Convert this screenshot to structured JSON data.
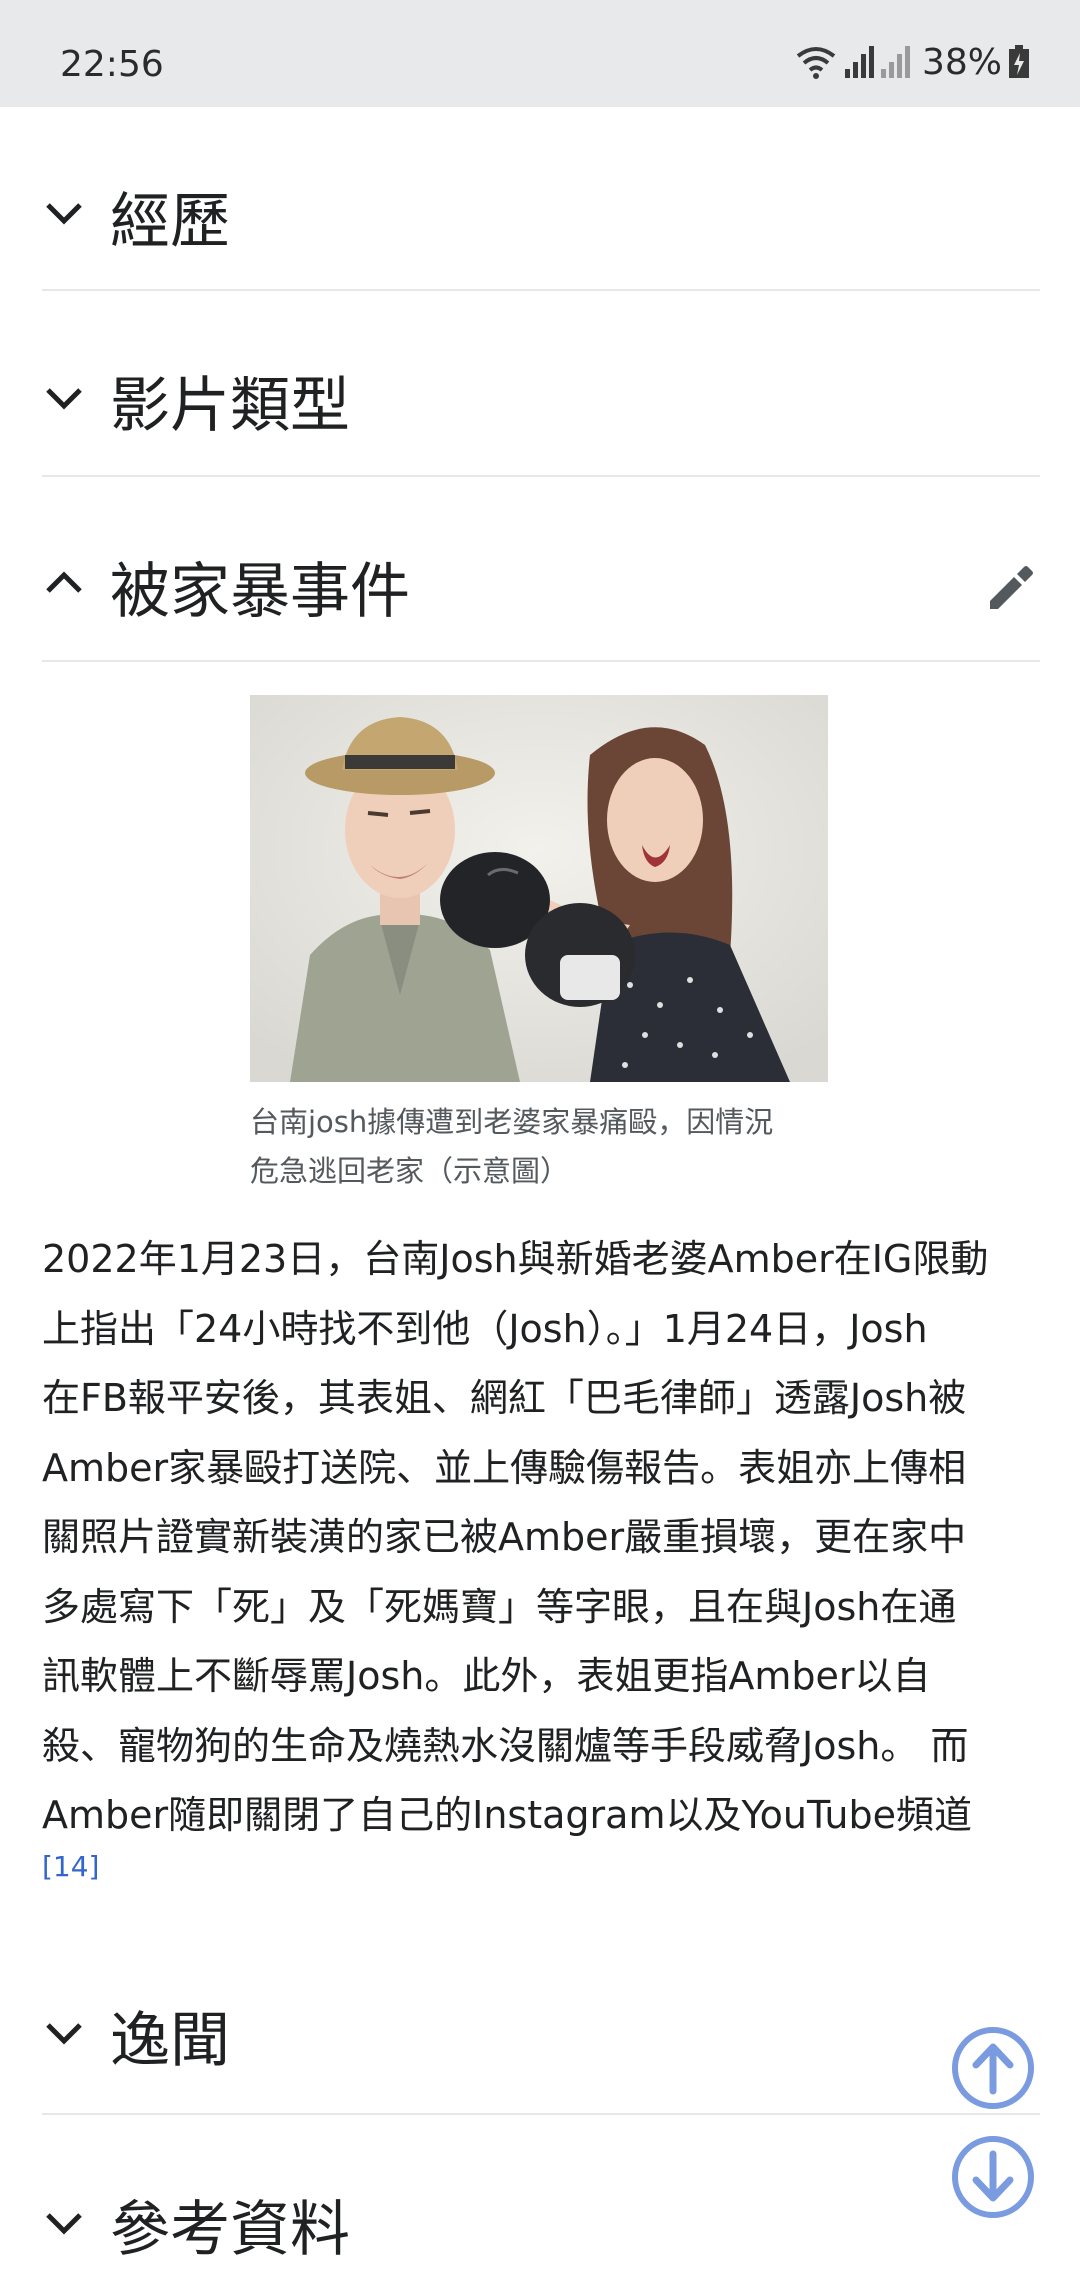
{
  "status_bar": {
    "time": "22:56",
    "battery": "38%"
  },
  "sections": {
    "career": {
      "title": "經歷",
      "state": "collapsed"
    },
    "video_types": {
      "title": "影片類型",
      "state": "collapsed"
    },
    "domestic_violence": {
      "title": "被家暴事件",
      "state": "expanded"
    },
    "anecdotes": {
      "title": "逸聞",
      "state": "collapsed"
    },
    "references": {
      "title": "參考資料",
      "state": "collapsed"
    }
  },
  "figure": {
    "caption_line1": "台南josh據傳遭到老婆家暴痛毆，因情況",
    "caption_line2": "危急逃回老家（示意圖）"
  },
  "article": {
    "lines": [
      "2022年1月23日，台南Josh與新婚老婆Amber在IG限動",
      "上指出「24小時找不到他（Josh）。」1月24日，Josh",
      "在FB報平安後，其表姐、網紅「巴毛律師」透露Josh被",
      "Amber家暴毆打送院、並上傳驗傷報告。表姐亦上傳相",
      "關照片證實新裝潢的家已被Amber嚴重損壞，更在家中",
      "多處寫下「死」及「死媽寶」等字眼，且在與Josh在通",
      "訊軟體上不斷辱罵Josh。此外，表姐更指Amber以自",
      "殺、寵物狗的生命及燒熱水沒關爐等手段威脅Josh。 而",
      "Amber隨即關閉了自己的Instagram以及YouTube頻道"
    ],
    "reference": "[14]"
  },
  "icons": {
    "chevron_down": "chevron-down-icon",
    "chevron_up": "chevron-up-icon",
    "edit": "pencil-icon",
    "scroll_up": "arrow-up-circle-icon",
    "scroll_down": "arrow-down-circle-icon"
  },
  "colors": {
    "link": "#3366cc",
    "fab": "#7a9be0",
    "divider": "#e6e7e9",
    "status_bar_bg": "#e8e9eb"
  }
}
